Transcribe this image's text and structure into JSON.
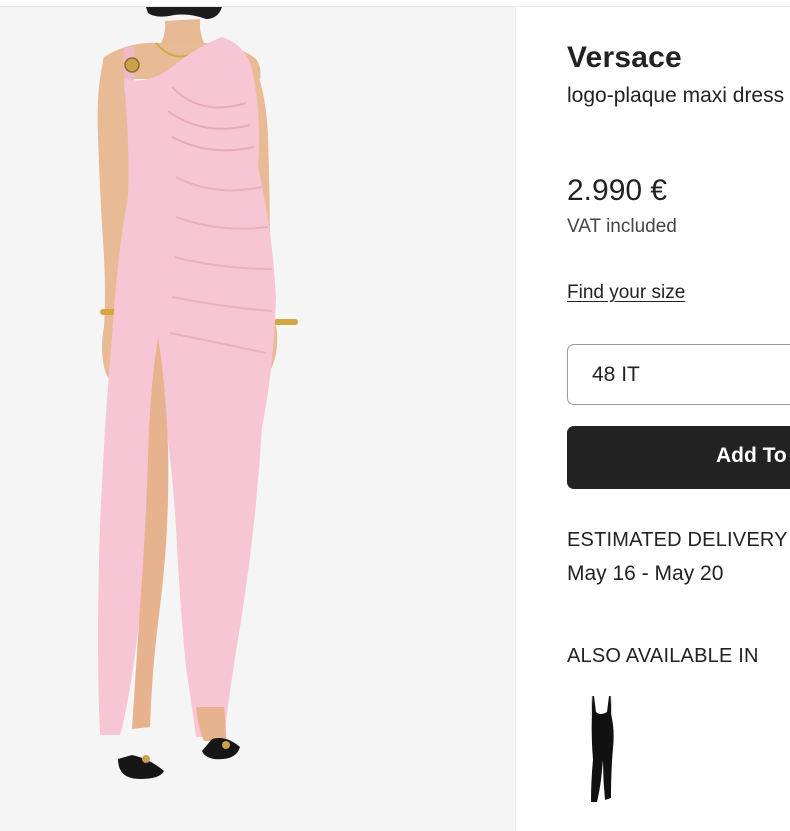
{
  "product": {
    "brand": "Versace",
    "name": "logo-plaque maxi dress",
    "price": "2.990 €",
    "vat_note": "VAT included",
    "dress_color": "#f6c6d4"
  },
  "size": {
    "find_link": "Find your size",
    "selected": "48 IT"
  },
  "cart": {
    "add_label": "Add To Bag"
  },
  "delivery": {
    "label": "ESTIMATED DELIVERY",
    "dates": "May 16 - May 20"
  },
  "variants": {
    "label": "ALSO AVAILABLE IN",
    "items": [
      {
        "color": "#111111"
      }
    ]
  },
  "colors": {
    "button_bg": "#222222",
    "image_bg": "#f5f5f5"
  }
}
